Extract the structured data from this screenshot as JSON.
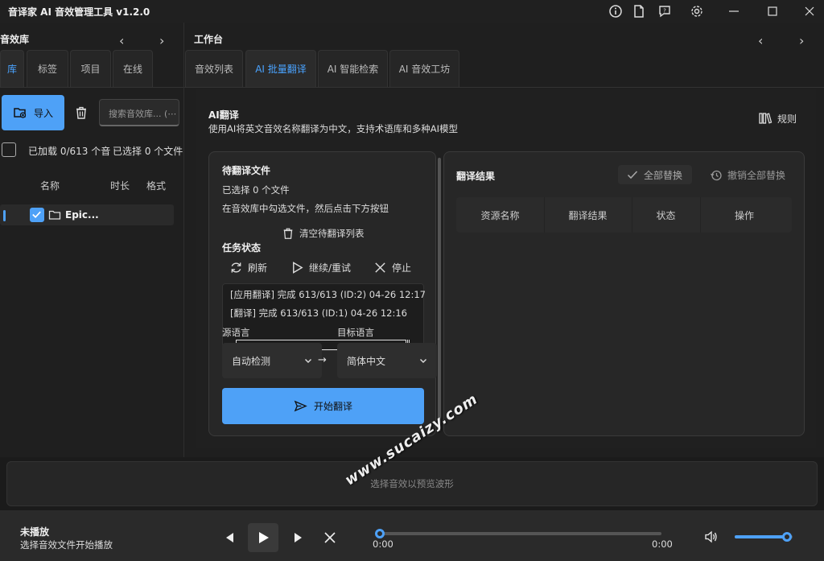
{
  "app": {
    "title": "音译家 AI 音效管理工具 v1.2.0"
  },
  "library": {
    "header": "音效库",
    "tabs": [
      {
        "label": "库",
        "active": true
      },
      {
        "label": "标签"
      },
      {
        "label": "项目"
      },
      {
        "label": "在线"
      }
    ],
    "import_label": "导入",
    "search_placeholder": "搜索音效库... (⋯",
    "loaded_status": "已加载 0/613 个音",
    "selected_status": "已选择 0 个文件",
    "columns": {
      "name": "名称",
      "duration": "时长",
      "format": "格式"
    },
    "rows": [
      {
        "name": "Epic...",
        "checked": true
      }
    ]
  },
  "workbench": {
    "header": "工作台",
    "tabs": [
      {
        "label": "音效列表"
      },
      {
        "label": "AI 批量翻译",
        "active": true
      },
      {
        "label": "AI 智能检索"
      },
      {
        "label": "AI 音效工坊"
      }
    ],
    "ai_title": "AI翻译",
    "ai_desc": "使用AI将英文音效名称翻译为中文，支持术语库和多种AI模型",
    "rules_label": "规则",
    "pending": {
      "title": "待翻译文件",
      "selected": "已选择 0 个文件",
      "hint": "在音效库中勾选文件，然后点击下方按钮",
      "clear_label": "清空待翻译列表"
    },
    "task": {
      "title": "任务状态",
      "refresh": "刷新",
      "resume": "继续/重试",
      "stop": "停止",
      "logs": [
        "[应用翻译] 完成  613/613  (ID:2)  04-26 12:17",
        "[翻译] 完成  613/613  (ID:1)  04-26 12:16"
      ]
    },
    "source_lang_label": "源语言",
    "target_lang_label": "目标语言",
    "source_lang": "自动检测",
    "target_lang": "简体中文",
    "arrow": "→",
    "start_label": "开始翻译",
    "results": {
      "title": "翻译结果",
      "replace_all": "全部替换",
      "undo_all": "撤销全部替换",
      "columns": [
        "资源名称",
        "翻译结果",
        "状态",
        "操作"
      ]
    }
  },
  "waveform": {
    "hint": "选择音效以预览波形"
  },
  "player": {
    "status": "未播放",
    "hint": "选择音效文件开始播放",
    "time_current": "0:00",
    "time_total": "0:00",
    "progress": 0,
    "volume": 0.9
  },
  "watermark": "www.sucaizy.com",
  "colors": {
    "accent": "#4ea1f7",
    "background": "#202020",
    "card": "#272727"
  }
}
